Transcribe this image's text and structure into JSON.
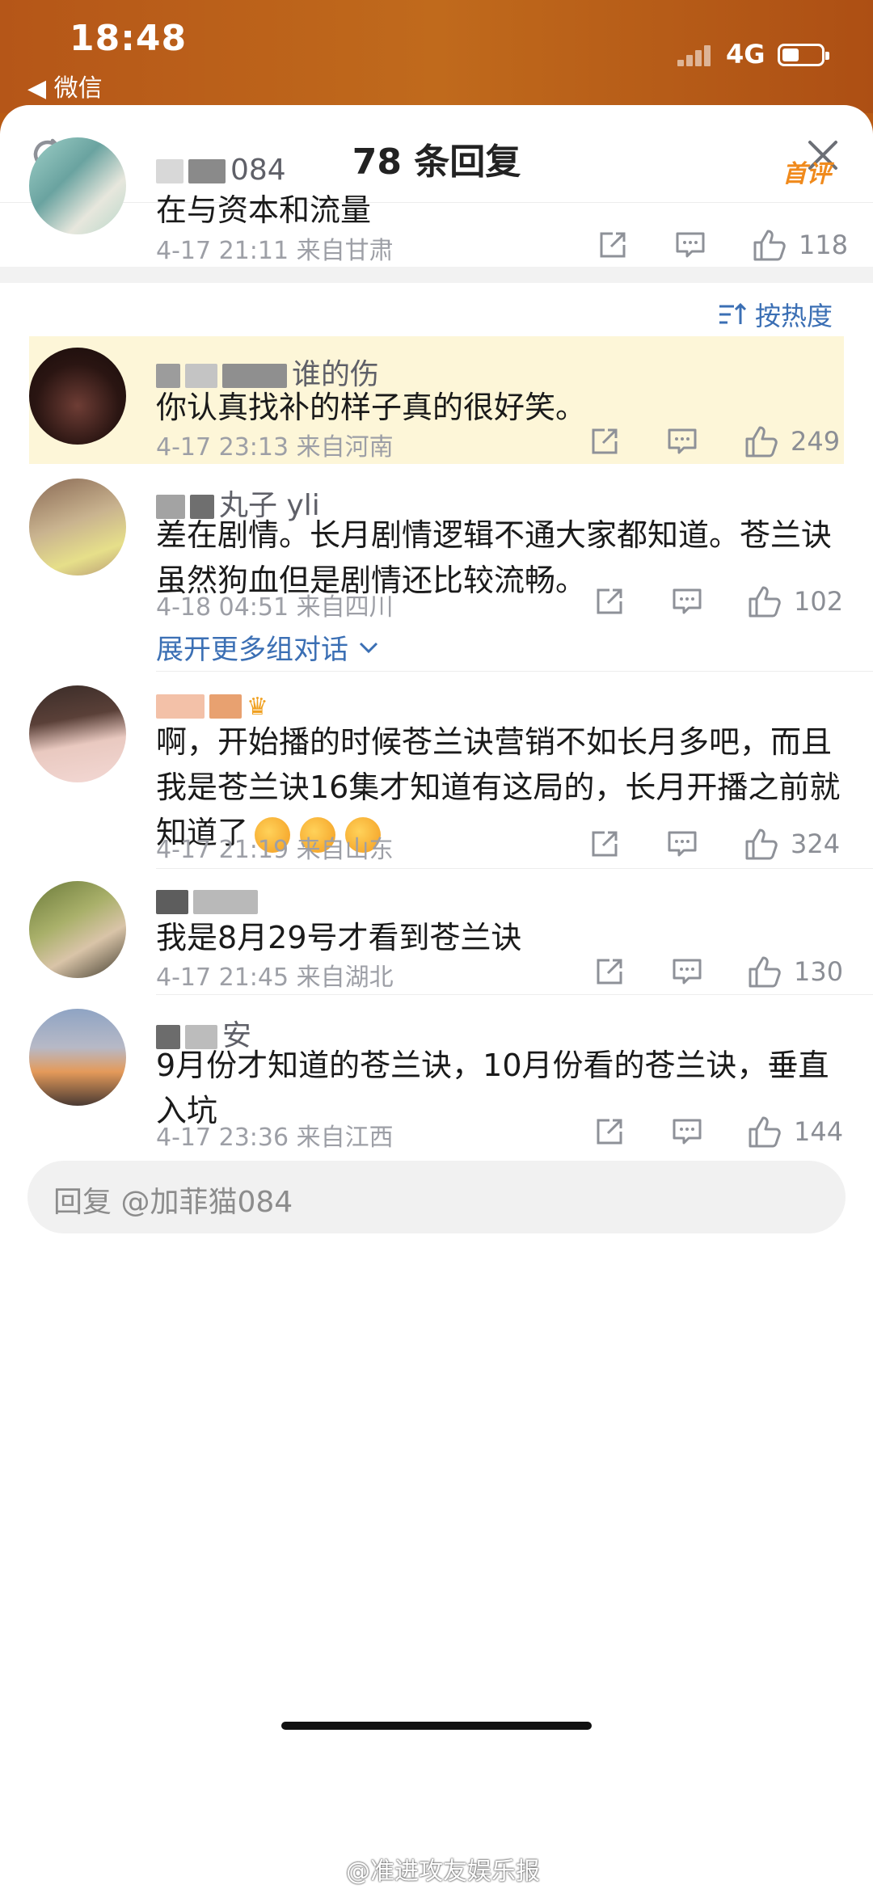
{
  "status_bar": {
    "time": "18:48",
    "back_label": "◀ 微信",
    "network": "4G"
  },
  "header": {
    "title": "78 条回复",
    "refresh_icon": "refresh-icon",
    "close_icon": "close-icon"
  },
  "main_comment": {
    "username_visible": "084",
    "badge": "首评",
    "text": "在与资本和流量",
    "timestamp": "4-17 21:11",
    "location": "来自甘肃",
    "likes": "118"
  },
  "sort_label": "按热度",
  "replies": [
    {
      "username_visible": "谁的伤",
      "text": "你认真找补的样子真的很好笑。",
      "timestamp": "4-17 23:13",
      "location": "来自河南",
      "likes": "249",
      "highlighted": true
    },
    {
      "username_visible": "丸子 yli",
      "text": "差在剧情。长月剧情逻辑不通大家都知道。苍兰诀虽然狗血但是剧情还比较流畅。",
      "timestamp": "4-18 04:51",
      "location": "来自四川",
      "likes": "102",
      "expand_label": "展开更多组对话"
    },
    {
      "username_visible": "",
      "text": "啊，开始播的时候苍兰诀营销不如长月多吧，而且我是苍兰诀16集才知道有这局的，长月开播之前就知道了",
      "timestamp": "4-17 21:19",
      "location": "来自山东",
      "likes": "324"
    },
    {
      "username_visible": "",
      "text": "我是8月29号才看到苍兰诀",
      "timestamp": "4-17 21:45",
      "location": "来自湖北",
      "likes": "130"
    },
    {
      "username_visible": "安",
      "text": "9月份才知道的苍兰诀，10月份看的苍兰诀，垂直入坑",
      "timestamp": "4-17 23:36",
      "location": "来自江西",
      "likes": "144"
    }
  ],
  "reply_input": {
    "placeholder": "回复 @加菲猫084"
  },
  "watermark": "@准进攻友娱乐报"
}
